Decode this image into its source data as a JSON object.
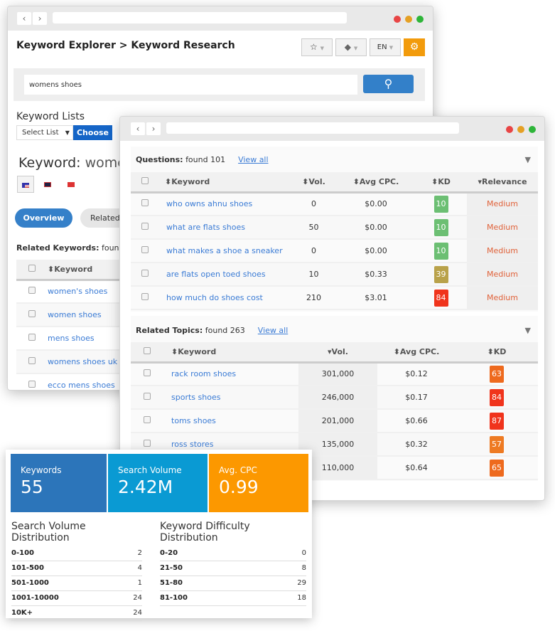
{
  "win1": {
    "title": "Keyword Explorer > Keyword Research",
    "lang": "EN",
    "search_value": "womens shoes",
    "lists_label": "Keyword Lists",
    "select_list": "Select List",
    "choose": "Choose",
    "keyword_label": "Keyword:",
    "keyword_value": "womens shoes",
    "flags": [
      "us-flag-icon",
      "au-flag-icon",
      "hk-flag-icon"
    ],
    "tabs": [
      "Overview",
      "Related"
    ],
    "related_title": "Related Keywords:",
    "related_found": "found",
    "col_keyword": "Keyword",
    "rows": [
      "women's shoes",
      "women shoes",
      "mens shoes",
      "womens shoes uk",
      "ecco mens shoes"
    ]
  },
  "win2": {
    "questions": {
      "title": "Questions:",
      "found": "found 101",
      "view_all": "View all",
      "cols": [
        "Keyword",
        "Vol.",
        "Avg CPC.",
        "KD",
        "Relevance"
      ],
      "rows": [
        {
          "kw": "who owns ahnu shoes",
          "vol": "0",
          "cpc": "$0.00",
          "kd": "10",
          "kd_color": "#6cbf73",
          "rel": "Medium"
        },
        {
          "kw": "what are flats shoes",
          "vol": "50",
          "cpc": "$0.00",
          "kd": "10",
          "kd_color": "#6cbf73",
          "rel": "Medium"
        },
        {
          "kw": "what makes a shoe a sneaker",
          "vol": "0",
          "cpc": "$0.00",
          "kd": "10",
          "kd_color": "#6cbf73",
          "rel": "Medium"
        },
        {
          "kw": "are flats open toed shoes",
          "vol": "10",
          "cpc": "$0.33",
          "kd": "39",
          "kd_color": "#b9a24a",
          "rel": "Medium"
        },
        {
          "kw": "how much do shoes cost",
          "vol": "210",
          "cpc": "$3.01",
          "kd": "84",
          "kd_color": "#f0341c",
          "rel": "Medium"
        }
      ]
    },
    "topics": {
      "title": "Related Topics:",
      "found": "found 263",
      "view_all": "View all",
      "cols": [
        "Keyword",
        "Vol.",
        "Avg CPC.",
        "KD"
      ],
      "rows": [
        {
          "kw": "rack room shoes",
          "vol": "301,000",
          "cpc": "$0.12",
          "kd": "63",
          "kd_color": "#ee6a1e"
        },
        {
          "kw": "sports shoes",
          "vol": "246,000",
          "cpc": "$0.17",
          "kd": "84",
          "kd_color": "#f0341c"
        },
        {
          "kw": "toms shoes",
          "vol": "201,000",
          "cpc": "$0.66",
          "kd": "87",
          "kd_color": "#f0341c"
        },
        {
          "kw": "ross stores",
          "vol": "135,000",
          "cpc": "$0.32",
          "kd": "57",
          "kd_color": "#ee7a22"
        },
        {
          "kw": "",
          "vol": "110,000",
          "cpc": "$0.64",
          "kd": "65",
          "kd_color": "#ee6a1e"
        }
      ]
    }
  },
  "summary": {
    "tiles": [
      {
        "label": "Keywords",
        "value": "55",
        "color": "#2c75ba"
      },
      {
        "label": "Search Volume",
        "value": "2.42M",
        "color": "#0a9ad3"
      },
      {
        "label": "Avg. CPC",
        "value": "0.99",
        "color": "#fc9800"
      }
    ],
    "svd": {
      "title": "Search Volume Distribution",
      "rows": [
        [
          "0-100",
          "2"
        ],
        [
          "101-500",
          "4"
        ],
        [
          "501-1000",
          "1"
        ],
        [
          "1001-10000",
          "24"
        ],
        [
          "10K+",
          "24"
        ]
      ]
    },
    "kdd": {
      "title": "Keyword Difficulty Distribution",
      "rows": [
        [
          "0-20",
          "0"
        ],
        [
          "21-50",
          "8"
        ],
        [
          "51-80",
          "29"
        ],
        [
          "81-100",
          "18"
        ]
      ]
    }
  }
}
